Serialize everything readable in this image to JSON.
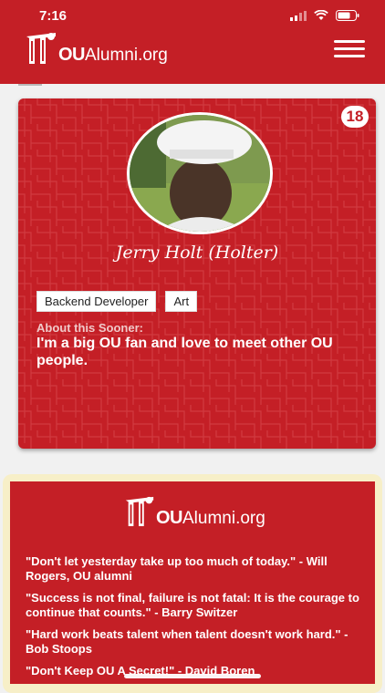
{
  "status": {
    "time": "7:16"
  },
  "header": {
    "logo_bold": "OU",
    "logo_rest": "Alumni.org"
  },
  "profile": {
    "badge": "18",
    "name": "Jerry Holt (Holter)",
    "tags": [
      "Backend Developer",
      "Art"
    ],
    "about_label": "About this Sooner:",
    "about_text": "I'm a big OU fan and love to meet other OU people."
  },
  "quotes_card": {
    "logo_bold": "OU",
    "logo_rest": "Alumni.org",
    "quotes": [
      "\"Don't let yesterday take up too much of today.\" - Will Rogers, OU alumni",
      "\"Success is not final, failure is not fatal: It is the courage to continue that counts.\" - Barry Switzer",
      "\"Hard work beats talent when talent doesn't work hard.\" - Bob Stoops",
      "\"Don't Keep OU A Secret!\" - David Boren"
    ]
  },
  "colors": {
    "brand_red": "#c41f26",
    "cream": "#f7efc8"
  }
}
